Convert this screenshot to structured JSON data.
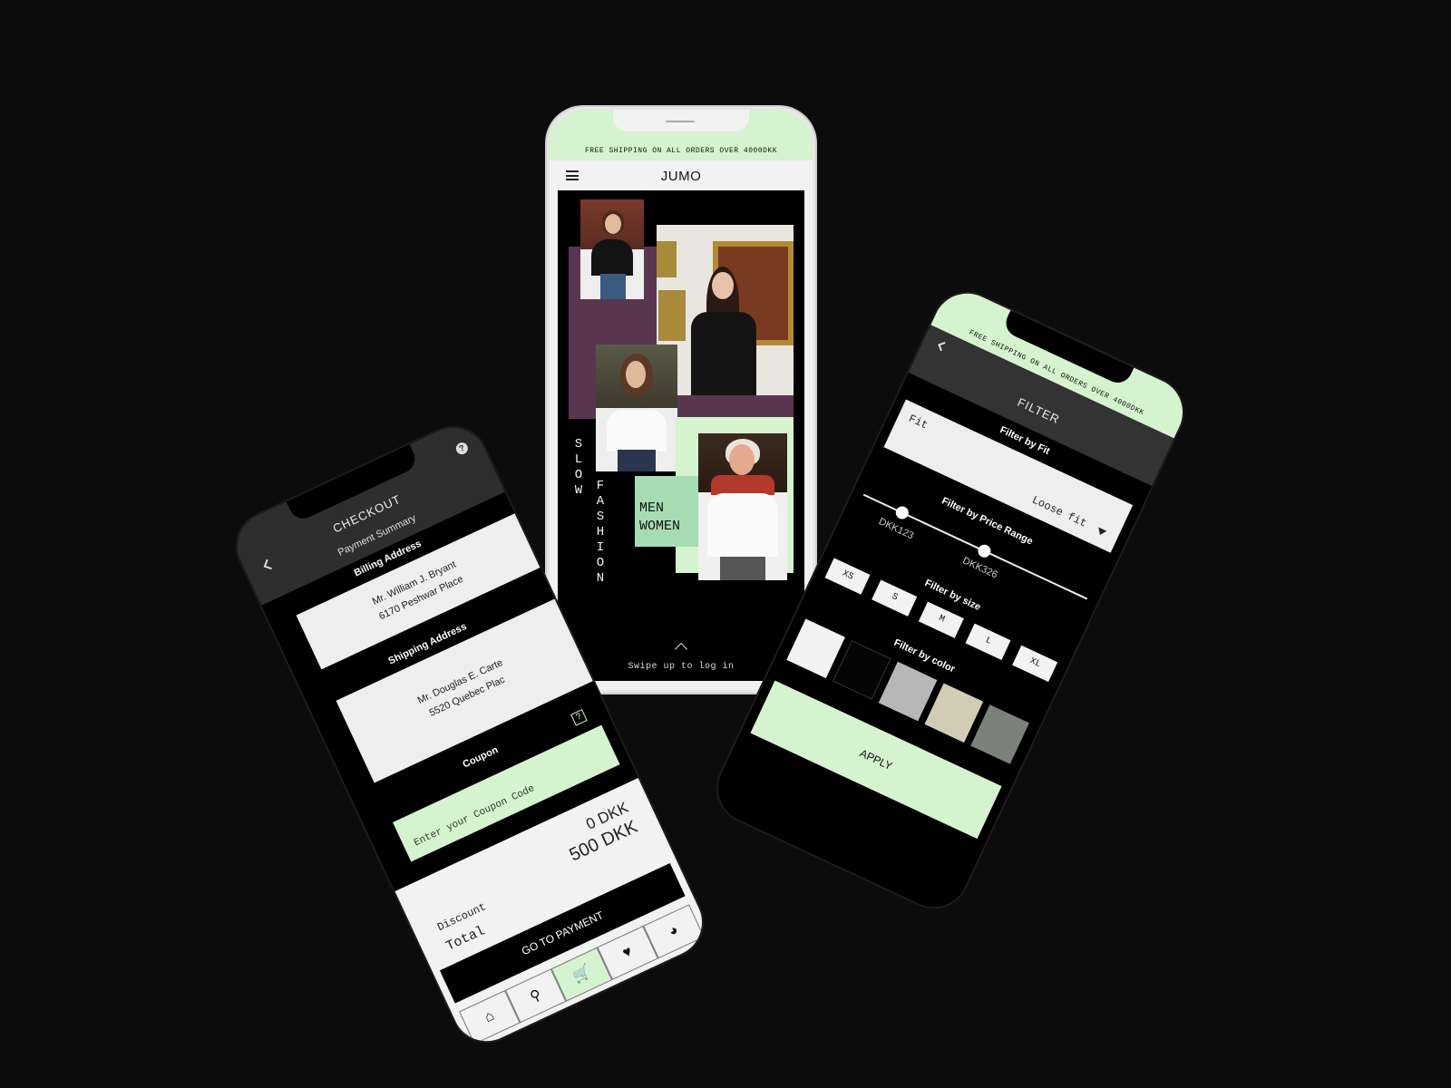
{
  "home": {
    "banner": "FREE SHIPPING ON ALL ORDERS OVER 4000DKK",
    "logo": "JUMO",
    "vertical_1": "SLOW",
    "vertical_2": "FASHION",
    "men": "MEN",
    "women": "WOMEN",
    "swipe": "Swipe up to log in",
    "colors": {
      "mint": "#d6f3cf",
      "plum": "#5a3550",
      "green": "#a6dcb4"
    }
  },
  "checkout": {
    "title": "CHECKOUT",
    "subtitle": "Payment Summary",
    "billing_heading": "Billing Address",
    "billing_name": "Mr. William J. Bryant",
    "billing_street": "6170 Peshwar Place",
    "shipping_heading": "Shipping Address",
    "shipping_name": "Mr. Douglas E. Carte",
    "shipping_street": "5520 Quebec Plac",
    "coupon_heading": "Coupon",
    "coupon_placeholder": "Enter your Coupon Code",
    "discount_label": "Discount",
    "total_label": "Total",
    "discount_value": "0 DKK",
    "total_value": "500 DKK",
    "pay_button": "GO TO PAYMENT",
    "tabs": [
      "home-icon",
      "search-icon",
      "cart-icon",
      "heart-icon",
      "profile-icon"
    ]
  },
  "filter": {
    "banner": "FREE SHIPPING ON ALL ORDERS OVER 4000DKK",
    "title": "FILTER",
    "fit_heading": "Filter by Fit",
    "fit_label": "Fit",
    "fit_value": "Loose fit",
    "price_heading": "Filter by Price Range",
    "price_min": "DKK123",
    "price_max": "DKK326",
    "size_heading": "Filter by size",
    "sizes": [
      "XS",
      "S",
      "M",
      "L",
      "XL"
    ],
    "color_heading": "Filter by color",
    "swatches": [
      "#f2f2f2",
      "#050505",
      "#b7b7b7",
      "#d3cbb3",
      "#7c817b"
    ],
    "apply": "APPLY"
  }
}
